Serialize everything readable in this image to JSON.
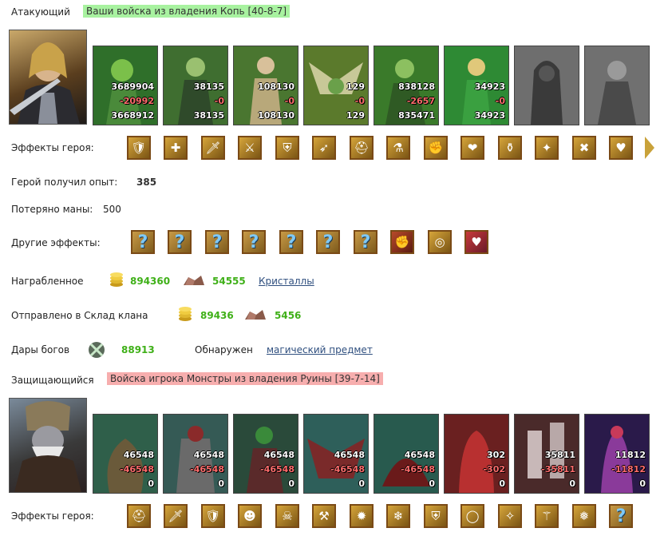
{
  "attacker": {
    "label": "Атакующий",
    "source": "Ваши войска из владения Копь [40-8-7]",
    "units": [
      {
        "top": "3689904",
        "mid": "-20992",
        "bot": "3668912",
        "color": "#2f6f2a"
      },
      {
        "top": "38135",
        "mid": "-0",
        "bot": "38135",
        "color": "#3f6e30"
      },
      {
        "top": "108130",
        "mid": "-0",
        "bot": "108130",
        "color": "#4a7630"
      },
      {
        "top": "129",
        "mid": "-0",
        "bot": "129",
        "color": "#5b7a2c"
      },
      {
        "top": "838128",
        "mid": "-2657",
        "bot": "835471",
        "color": "#3a7a2a"
      },
      {
        "top": "34923",
        "mid": "-0",
        "bot": "34923",
        "color": "#2e8a34"
      },
      {
        "top": "",
        "mid": "",
        "bot": "",
        "color": "#6e6e6e"
      },
      {
        "top": "",
        "mid": "",
        "bot": "",
        "color": "#707070"
      }
    ],
    "hero_effects_label": "Эффекты героя:",
    "hero_effects": [
      "shield-icon",
      "cross-icon",
      "sword-icon",
      "swords-icon",
      "armor-icon",
      "bows-icon",
      "helmet-icon",
      "potion-icon",
      "fist-icon",
      "heart-icon",
      "flask-icon",
      "blade-icon",
      "crossed-blades-icon",
      "heart-gem-icon"
    ],
    "exp_label": "Герой получил опыт:",
    "exp_value": "385",
    "mana_label": "Потеряно маны:",
    "mana_value": "500",
    "other_effects_label": "Другие эффекты:",
    "other_effects": [
      "?",
      "?",
      "?",
      "?",
      "?",
      "?",
      "?"
    ],
    "other_effects_icons": [
      "fist-heart-icon",
      "coins-icon",
      "heart-arrow-icon"
    ]
  },
  "loot": {
    "label": "Награбленное",
    "gold": "894360",
    "ore": "54555",
    "link": "Кристаллы"
  },
  "clan": {
    "label": "Отправлено в Склад клана",
    "gold": "89436",
    "ore": "5456"
  },
  "gifts": {
    "label": "Дары богов",
    "value": "88913",
    "found_label": "Обнаружен",
    "found_link": "магический предмет"
  },
  "defender": {
    "label": "Защищающийся",
    "source": "Войска игрока Монстры из владения Руины [39-7-14]",
    "units": [
      {
        "top": "46548",
        "mid": "-46548",
        "bot": "0",
        "color": "#2f5f4a"
      },
      {
        "top": "46548",
        "mid": "-46548",
        "bot": "0",
        "color": "#355a55"
      },
      {
        "top": "46548",
        "mid": "-46548",
        "bot": "0",
        "color": "#2a4a3a"
      },
      {
        "top": "46548",
        "mid": "-46548",
        "bot": "0",
        "color": "#2e5f5a"
      },
      {
        "top": "46548",
        "mid": "-46548",
        "bot": "0",
        "color": "#285a4e"
      },
      {
        "top": "302",
        "mid": "-302",
        "bot": "0",
        "color": "#6a2020"
      },
      {
        "top": "35811",
        "mid": "-35811",
        "bot": "0",
        "color": "#4a2a2a"
      },
      {
        "top": "11812",
        "mid": "-11812",
        "bot": "0",
        "color": "#2a1a4a"
      }
    ],
    "hero_effects_label": "Эффекты героя:",
    "hero_effects": [
      "helmet-icon",
      "sword-icon",
      "shield-icon",
      "warrior-icon",
      "skull-icon",
      "tools-icon",
      "fire-icon",
      "frost-icon",
      "armor-icon",
      "ring-icon",
      "wand-icon",
      "staff-icon",
      "ice-icon",
      "?"
    ]
  }
}
